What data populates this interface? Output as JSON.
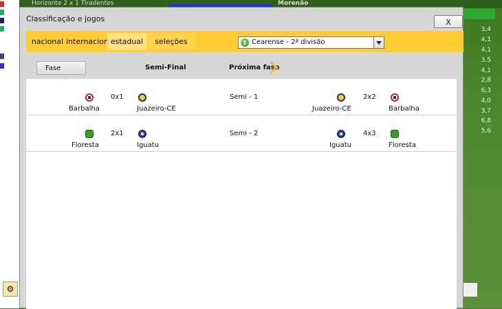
{
  "background": {
    "top_left_text": "Horizonte  2 x 1  Tiradentes",
    "top_right_text": "Morenão",
    "right_values": [
      "3,4",
      "4,1",
      "4,1",
      "3,5",
      "4,1",
      "2,8",
      "6,3",
      "4,0",
      "3,7",
      "6,8",
      "5,6"
    ]
  },
  "dialog": {
    "title": "Classificação e jogos",
    "close_label": "X",
    "tabs": [
      {
        "label": "nacional",
        "selected": false
      },
      {
        "label": "internacional",
        "selected": false
      },
      {
        "label": "estadual",
        "selected": true
      },
      {
        "label": "seleções",
        "selected": false
      }
    ],
    "competition_select": {
      "value": "Cearense - 2ª divisão",
      "icon": "soccer-ball-icon"
    },
    "prev_phase_label": "Fase anterior",
    "phase_title": "Semi-Final",
    "next_phase_label": "Próxima fase"
  },
  "matches": [
    {
      "name": "Semi - 1",
      "leg1": {
        "home": "Barbalha",
        "home_logo": "barbalha-crest-icon",
        "score": "0x1",
        "away": "Juazeiro-CE",
        "away_logo": "juazeiro-crest-icon"
      },
      "leg2": {
        "home": "Juazeiro-CE",
        "home_logo": "juazeiro-crest-icon",
        "score": "2x2",
        "away": "Barbalha",
        "away_logo": "barbalha-crest-icon"
      }
    },
    {
      "name": "Semi - 2",
      "leg1": {
        "home": "Floresta",
        "home_logo": "floresta-crest-icon",
        "score": "2x1",
        "away": "Iguatu",
        "away_logo": "iguatu-crest-icon"
      },
      "leg2": {
        "home": "Iguatu",
        "home_logo": "iguatu-crest-icon",
        "score": "4x3",
        "away": "Floresta",
        "away_logo": "floresta-crest-icon"
      }
    }
  ],
  "colors": {
    "tab_bar": "#ffcc33",
    "tab_selected": "#ffe082",
    "dialog_bg": "#d6d6d6",
    "content_bg": "#ffffff",
    "background_green": "#4a7a2a"
  }
}
